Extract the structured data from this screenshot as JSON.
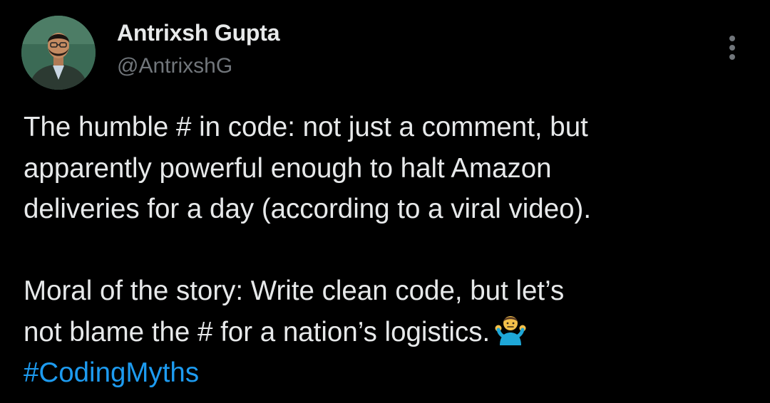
{
  "tweet": {
    "author": {
      "name": "Antrixsh Gupta",
      "handle": "@AntrixshG",
      "avatar_icon": "person-avatar"
    },
    "more_icon": "more-vertical-icon",
    "text": {
      "paragraph1": [
        "The humble # in code: not just a comment, but",
        "apparently powerful enough to halt Amazon",
        "deliveries for a day (according to a viral video)."
      ],
      "paragraph2": [
        "Moral of the story: Write clean code, but let’s",
        "not blame the # for a nation’s logistics."
      ],
      "emoji": "🤷‍♂️",
      "hashtag": "#CodingMyths"
    },
    "colors": {
      "background": "#000000",
      "text": "#e7e9ea",
      "secondary_text": "#71767b",
      "link": "#1d9bf0"
    }
  }
}
